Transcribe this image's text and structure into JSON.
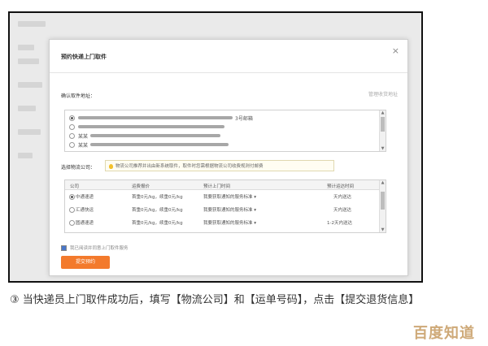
{
  "dialog": {
    "title": "预约快递上门取件",
    "close_icon": "close-icon",
    "address_label": "确认取件地址：",
    "address_manage": "管理收货地址",
    "addresses": [
      {
        "prefix": "",
        "suffix": "3号邮箱",
        "selected": true
      },
      {
        "prefix": "",
        "suffix": "",
        "selected": false
      },
      {
        "prefix": "某某",
        "suffix": "",
        "selected": false
      },
      {
        "prefix": "某某",
        "suffix": "",
        "selected": false
      }
    ],
    "company_label": "选择物流公司：",
    "company_hint": "物流公司推荐并出由新系统取件，取件时您需根据物流公司收费规则付邮费",
    "table": {
      "headers": [
        "公司",
        "运费报价",
        "预计上门时间",
        "预计运达时间"
      ],
      "rows": [
        {
          "company": "中通速递",
          "price": "首重0元/kg，续重0元/kg",
          "pickup": "我要获取通知的服务标准 ▾",
          "delivery": "天内送达",
          "selected": true
        },
        {
          "company": "汇通快运",
          "price": "首重0元/kg，续重0元/kg",
          "pickup": "我要获取通知的服务标准 ▾",
          "delivery": "天内送达",
          "selected": false
        },
        {
          "company": "圆通速递",
          "price": "首重0元/kg，续重0元/kg",
          "pickup": "我要获取通知的服务标准 ▾",
          "delivery": "1-2天内送达",
          "selected": false
        }
      ]
    },
    "agreement": "我已阅读并同意上门取件服务",
    "submit_label": "提交预约"
  },
  "caption": "③ 当快递员上门取件成功后，填写【物流公司】和【运单号码】，点击【提交退货信息】",
  "watermark": "百度知道",
  "colors": {
    "submit": "#f37a2c",
    "watermark": "#c9a06a"
  }
}
